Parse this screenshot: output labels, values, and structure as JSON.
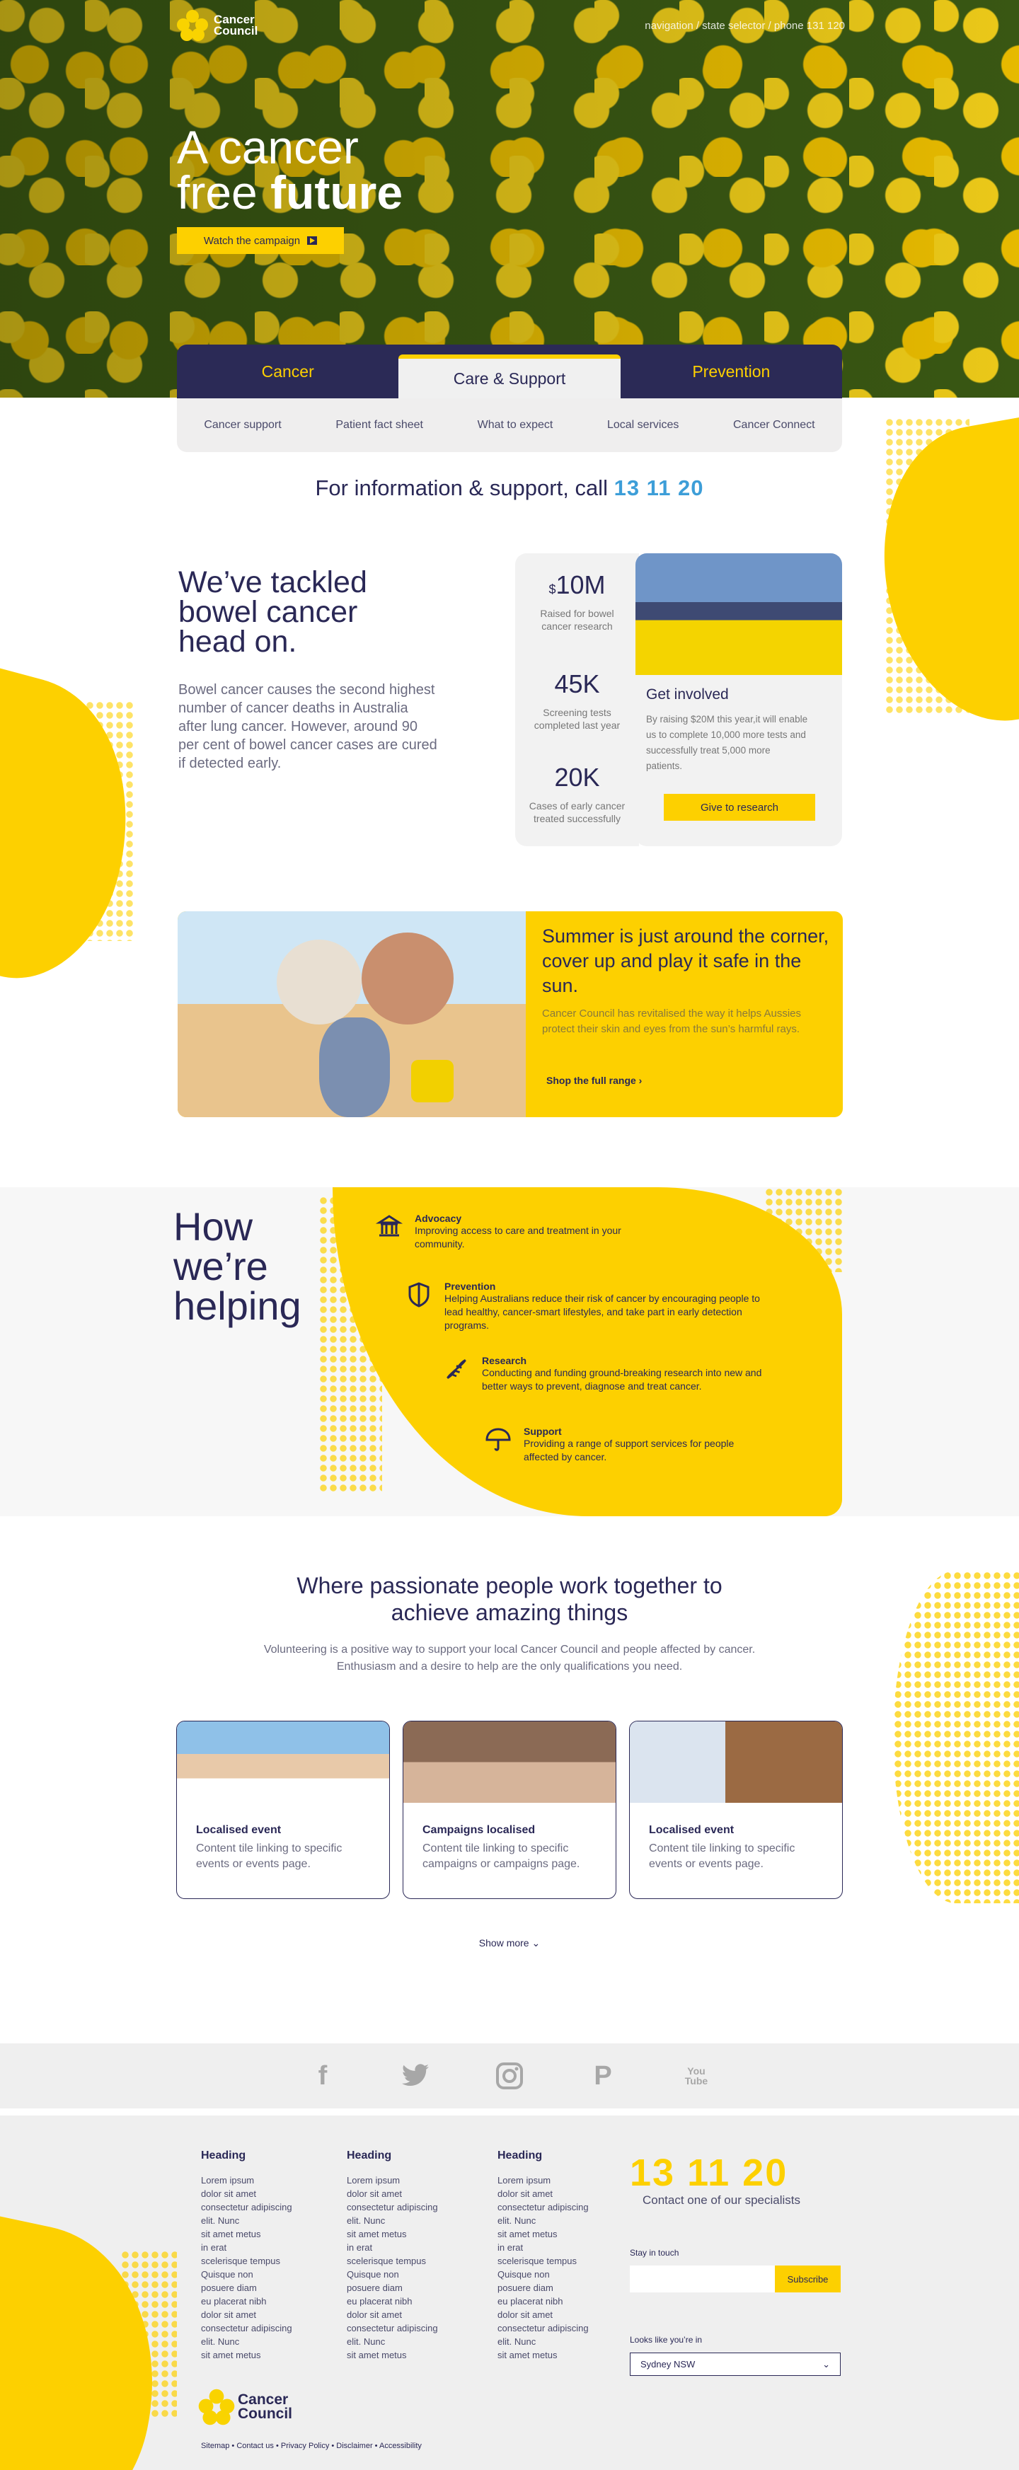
{
  "header": {
    "logo_line1": "Cancer",
    "logo_line2": "Council",
    "nav": "navigation / state selector / phone 131 120"
  },
  "hero": {
    "line1": "A cancer",
    "line2_pre": "free ",
    "line2_bold": "future",
    "cta": "Watch the campaign"
  },
  "tabs": [
    {
      "label": "Cancer"
    },
    {
      "label": "Care & Support"
    },
    {
      "label": "Prevention"
    }
  ],
  "subnav": [
    "Cancer support",
    "Patient fact sheet",
    "What to expect",
    "Local services",
    "Cancer Connect"
  ],
  "call": {
    "text": "For information & support, call ",
    "number": "13 11 20"
  },
  "bowel": {
    "title_l1": "We’ve tackled",
    "title_l2": "bowel cancer",
    "title_l3": "head on.",
    "body": "Bowel cancer causes the second highest number of cancer deaths in Australia after lung cancer. However, around 90 per cent of bowel cancer cases are cured if detected early.",
    "stats": [
      {
        "prefix": "$",
        "value": "10M",
        "label": "Raised for bowel cancer research"
      },
      {
        "prefix": "",
        "value": "45K",
        "label": "Screening tests completed last year"
      },
      {
        "prefix": "",
        "value": "20K",
        "label": "Cases of early cancer treated successfully"
      }
    ],
    "involved": {
      "title": "Get involved",
      "body": "By raising $20M this year,it will enable us to complete 10,000 more tests and successfully treat 5,000 more patients.",
      "cta": "Give to research"
    }
  },
  "summer": {
    "title": "Summer is just around the corner, cover up and play it safe in the sun.",
    "body": "Cancer Council has revitalised the way it helps Aussies protect their skin and eyes from the sun’s harmful rays.",
    "cta": "Shop the full range"
  },
  "helping": {
    "title_l1": "How",
    "title_l2": "we’re",
    "title_l3": "helping",
    "items": [
      {
        "title": "Advocacy",
        "desc": "Improving access to care and treatment in your community.",
        "icon": "building-icon"
      },
      {
        "title": "Prevention",
        "desc": "Helping Australians reduce their risk of cancer by encouraging people to lead healthy, cancer-smart lifestyles, and take part in early detection programs.",
        "icon": "shield-icon"
      },
      {
        "title": "Research",
        "desc": "Conducting and funding ground-breaking research into new and better ways to prevent, diagnose and treat cancer.",
        "icon": "dna-icon"
      },
      {
        "title": "Support",
        "desc": "Providing a range of support services for people affected by cancer.",
        "icon": "umbrella-icon"
      }
    ]
  },
  "volunteer": {
    "title_l1": "Where passionate people work together to",
    "title_l2": "achieve amazing things",
    "body_l1": "Volunteering is a positive way to support your local Cancer Council and people affected by cancer.",
    "body_l2": "Enthusiasm and a desire to help are the only qualifications you need.",
    "tiles": [
      {
        "title": "Localised event",
        "desc": "Content  tile linking to specific events or events page."
      },
      {
        "title": "Campaigns localised",
        "desc": "Content  tile linking to specific campaigns or campaigns page."
      },
      {
        "title": "Localised event",
        "desc": "Content  tile linking to specific events or events page."
      }
    ],
    "show_more": "Show more"
  },
  "social": {
    "icons": [
      "facebook-icon",
      "twitter-icon",
      "instagram-icon",
      "pinterest-icon",
      "youtube-icon"
    ],
    "youtube_label": "You Tube"
  },
  "footer": {
    "columns": [
      {
        "heading": "Heading",
        "links": [
          "Lorem ipsum",
          "dolor sit amet",
          "consectetur adipiscing",
          "elit. Nunc",
          "sit amet metus",
          "in erat",
          "scelerisque tempus",
          "Quisque non",
          "posuere diam",
          "eu placerat nibh",
          "dolor sit amet",
          "consectetur adipiscing",
          "elit. Nunc",
          "sit amet metus"
        ]
      },
      {
        "heading": "Heading",
        "links": [
          "Lorem ipsum",
          "dolor sit amet",
          "consectetur adipiscing",
          "elit. Nunc",
          "sit amet metus",
          "in erat",
          "scelerisque tempus",
          "Quisque non",
          "posuere diam",
          "eu placerat nibh",
          "dolor sit amet",
          "consectetur adipiscing",
          "elit. Nunc",
          "sit amet metus"
        ]
      },
      {
        "heading": "Heading",
        "links": [
          "Lorem ipsum",
          "dolor sit amet",
          "consectetur adipiscing",
          "elit. Nunc",
          "sit amet metus",
          "in erat",
          "scelerisque tempus",
          "Quisque non",
          "posuere diam",
          "eu placerat nibh",
          "dolor sit amet",
          "consectetur adipiscing",
          "elit. Nunc",
          "sit amet metus"
        ]
      }
    ],
    "phone": "13 11 20",
    "phone_sub": "Contact one of our  specialists",
    "stay_label": "Stay in touch",
    "email_placeholder": "",
    "subscribe": "Subscribe",
    "location_label": "Looks like you’re in",
    "location_value": "Sydney NSW",
    "legal": "Sitemap • Contact us • Privacy Policy • Disclaimer • Accessibility"
  },
  "colors": {
    "navy": "#2a2856",
    "yellow": "#fdd000",
    "blue": "#3d9ed8"
  }
}
